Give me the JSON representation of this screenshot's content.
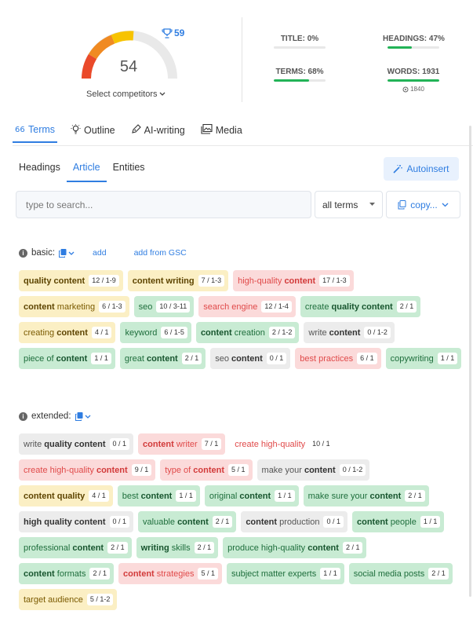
{
  "score": {
    "value": "54",
    "trophy_value": "59",
    "select_label": "Select competitors"
  },
  "metrics": {
    "title": {
      "label": "TITLE: 0%",
      "progress": 0
    },
    "headings": {
      "label": "HEADINGS: 47%",
      "progress": 0.47
    },
    "terms": {
      "label": "TERMS: 68%",
      "progress": 0.68
    },
    "words": {
      "label": "WORDS: 1931",
      "progress": 1.0,
      "target": "1840"
    }
  },
  "main_tabs": [
    {
      "label": "Terms",
      "icon": "terms-icon",
      "active": true
    },
    {
      "label": "Outline",
      "icon": "lightbulb-icon"
    },
    {
      "label": "AI-writing",
      "icon": "pen-icon"
    },
    {
      "label": "Media",
      "icon": "image-icon"
    }
  ],
  "sub_tabs": [
    {
      "label": "Headings"
    },
    {
      "label": "Article",
      "active": true
    },
    {
      "label": "Entities"
    }
  ],
  "autoinsert_label": "Autoinsert",
  "search": {
    "placeholder": "type to search..."
  },
  "filter": {
    "value": "all terms"
  },
  "copy_label": "copy...",
  "basic": {
    "label": "basic:",
    "add": "add",
    "add_gsc": "add from GSC"
  },
  "extended": {
    "label": "extended:"
  },
  "colors": {
    "accent": "#2f7de1",
    "green": "#c8ebd3",
    "yellow": "#fbefc4",
    "red": "#fbdada",
    "gray": "#ececec"
  }
}
